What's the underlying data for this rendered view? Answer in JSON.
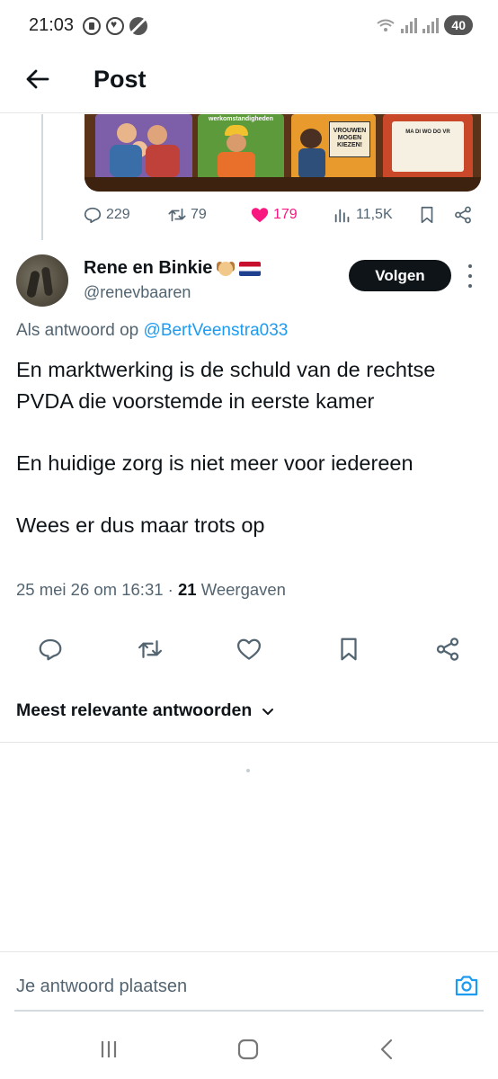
{
  "status_bar": {
    "time": "21:03",
    "battery": "40"
  },
  "header": {
    "title": "Post"
  },
  "previous_post": {
    "image_texts": [
      "werkomstandigheden",
      "VROUWEN MOGEN KIEZEN!",
      "MA DI WO DO VR"
    ],
    "actions": {
      "replies": "229",
      "reposts": "79",
      "likes": "179",
      "views": "11,5K"
    },
    "like_color": "#f91880"
  },
  "tweet": {
    "display_name": "Rene en Binkie",
    "handle": "@renevbaaren",
    "follow_label": "Volgen",
    "reply_prefix": "Als antwoord op",
    "reply_to": "@BertVeenstra033",
    "paragraphs": [
      "En marktwerking is de schuld van de rechtse PVDA die voorstemde in eerste kamer",
      "En huidige zorg is niet meer voor iedereen",
      "Wees er dus maar trots op"
    ],
    "timestamp": "25 mei 26 om 16:31",
    "separator": "·",
    "views_count": "21",
    "views_label": "Weergaven"
  },
  "sort": {
    "label": "Meest relevante antwoorden"
  },
  "composer": {
    "placeholder": "Je antwoord plaatsen"
  },
  "colors": {
    "accent": "#1d9bf0",
    "text": "#0f1419",
    "secondary": "#536471"
  },
  "icons": [
    "back-arrow-icon",
    "reply-icon",
    "repost-icon",
    "heart-icon",
    "views-icon",
    "bookmark-icon",
    "share-icon",
    "more-icon",
    "chevron-down-icon",
    "camera-icon"
  ]
}
